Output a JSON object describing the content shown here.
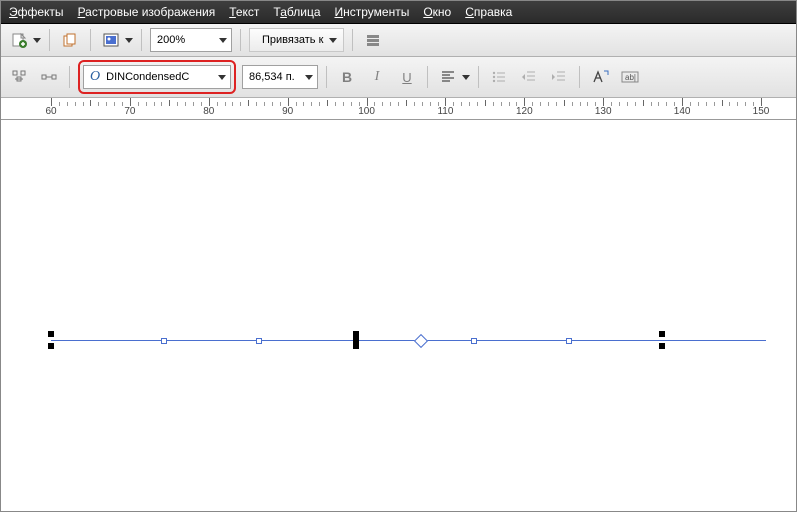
{
  "menu": {
    "effects": "Эффекты",
    "bitmaps": "Растровые изображения",
    "text": "Текст",
    "table": "Таблица",
    "tools": "Инструменты",
    "window": "Окно",
    "help": "Справка"
  },
  "toolbar1": {
    "zoom": "200%",
    "snap_label": "Привязать к"
  },
  "toolbar2": {
    "font_name": "DINCondensedC",
    "font_size": "86,534 п.",
    "font_glyph": "O"
  },
  "ruler": {
    "ticks": [
      60,
      70,
      80,
      90,
      100,
      110,
      120,
      130,
      140,
      150
    ]
  }
}
